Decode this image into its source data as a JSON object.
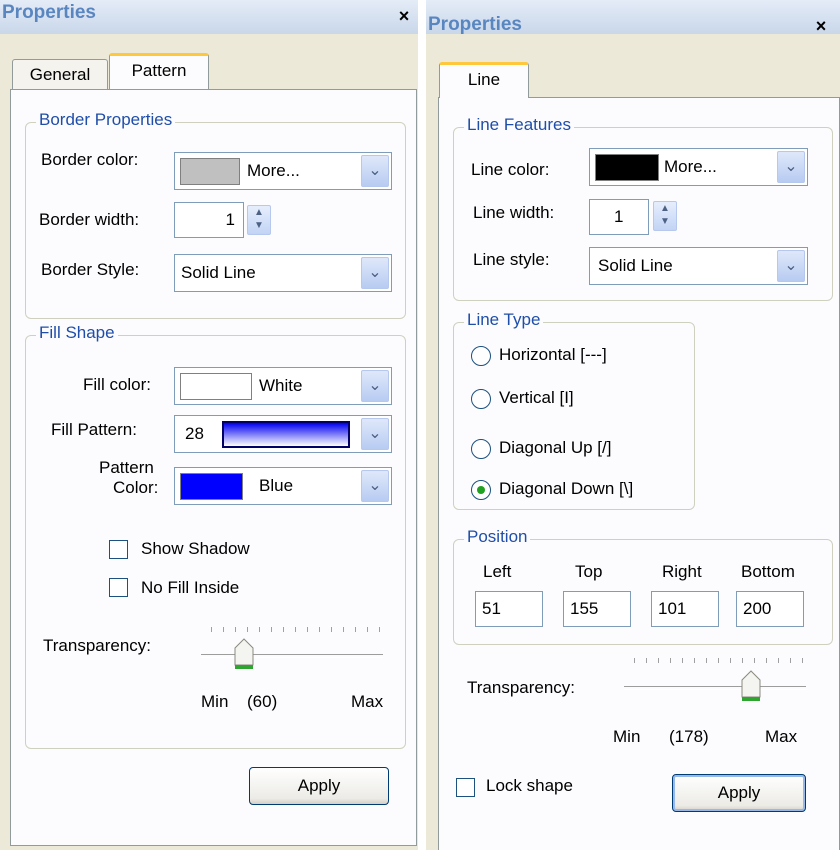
{
  "left_panel": {
    "title": "Properties",
    "close_label": "×",
    "tabs": [
      {
        "label": "General"
      },
      {
        "label": "Pattern"
      }
    ],
    "border_group": {
      "legend": "Border Properties",
      "border_color_label": "Border color:",
      "border_color_value": "More...",
      "border_color_swatch": "#c0c0c0",
      "border_width_label": "Border width:",
      "border_width_value": "1",
      "border_style_label": "Border Style:",
      "border_style_value": "Solid Line"
    },
    "fill_group": {
      "legend": "Fill Shape",
      "fill_color_label": "Fill color:",
      "fill_color_value": "White",
      "fill_color_swatch": "#ffffff",
      "fill_pattern_label": "Fill Pattern:",
      "fill_pattern_value": "28",
      "pattern_color_label_1": "Pattern",
      "pattern_color_label_2": "Color:",
      "pattern_color_value": "Blue",
      "pattern_color_swatch": "#0000ff",
      "show_shadow_label": "Show Shadow",
      "show_shadow_checked": false,
      "no_fill_label": "No Fill Inside",
      "no_fill_checked": false,
      "transparency_label": "Transparency:",
      "min_label": "Min",
      "max_label": "Max",
      "value_display": "(60)",
      "value": 60,
      "max": 255
    },
    "apply_label": "Apply"
  },
  "right_panel": {
    "title": "Properties",
    "close_label": "×",
    "tabs": [
      {
        "label": "Line"
      }
    ],
    "line_features": {
      "legend": "Line Features",
      "line_color_label": "Line color:",
      "line_color_value": "More...",
      "line_color_swatch": "#000000",
      "line_width_label": "Line width:",
      "line_width_value": "1",
      "line_style_label": "Line style:",
      "line_style_value": "Solid Line"
    },
    "line_type": {
      "legend": "Line Type",
      "options": [
        {
          "label": "Horizontal [---]",
          "selected": false
        },
        {
          "label": "Vertical [I]",
          "selected": false
        },
        {
          "label": "Diagonal Up [/]",
          "selected": false
        },
        {
          "label": "Diagonal Down [\\]",
          "selected": true
        }
      ]
    },
    "position": {
      "legend": "Position",
      "left_label": "Left",
      "top_label": "Top",
      "right_label": "Right",
      "bottom_label": "Bottom",
      "left_value": "51",
      "top_value": "155",
      "right_value": "101",
      "bottom_value": "200"
    },
    "transparency_label": "Transparency:",
    "min_label": "Min",
    "max_label": "Max",
    "value_display": "(178)",
    "value": 178,
    "max": 255,
    "lock_shape_label": "Lock shape",
    "lock_shape_checked": false,
    "apply_label": "Apply"
  },
  "colors": {
    "accent_blue": "#1f4ea9",
    "tab_highlight": "#ffc73c",
    "slider_green": "#2ea52e"
  }
}
